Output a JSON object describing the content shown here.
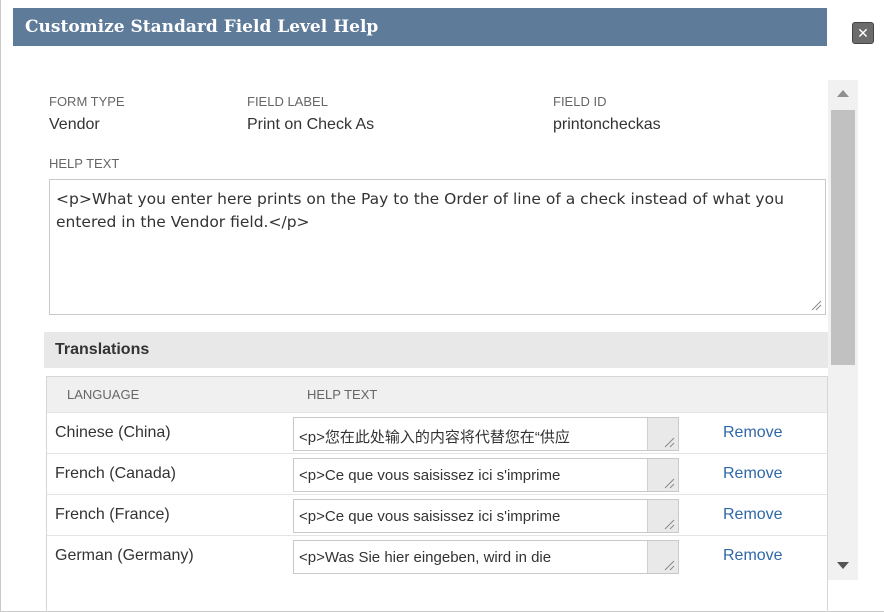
{
  "dialog": {
    "title": "Customize Standard Field Level Help",
    "close_glyph": "✕"
  },
  "fields": {
    "form_type_label": "FORM TYPE",
    "form_type_value": "Vendor",
    "field_label_label": "FIELD LABEL",
    "field_label_value": "Print on Check As",
    "field_id_label": "FIELD ID",
    "field_id_value": "printoncheckas",
    "help_text_label": "HELP TEXT",
    "help_text_value": "<p>What you enter here prints on the Pay to the Order of line of a check instead of what you entered in the Vendor field.</p>"
  },
  "translations": {
    "title": "Translations",
    "columns": {
      "language": "LANGUAGE",
      "help_text": "HELP TEXT"
    },
    "remove_label": "Remove",
    "rows": [
      {
        "language": "Chinese (China)",
        "help_text": "<p>您在此处输入的内容将代替您在“供应"
      },
      {
        "language": "French (Canada)",
        "help_text": "<p>Ce que vous saisissez ici s'imprime"
      },
      {
        "language": "French (France)",
        "help_text": "<p>Ce que vous saisissez ici s'imprime"
      },
      {
        "language": "German (Germany)",
        "help_text": "<p>Was Sie hier eingeben, wird in die"
      }
    ]
  },
  "colors": {
    "title_bar": "#5f7b9a",
    "link": "#2f68a8",
    "section_header": "#e8e8e8"
  },
  "icons": [
    "close-icon",
    "resize-grip-icon",
    "scroll-up-arrow-icon",
    "scroll-down-arrow-icon"
  ]
}
